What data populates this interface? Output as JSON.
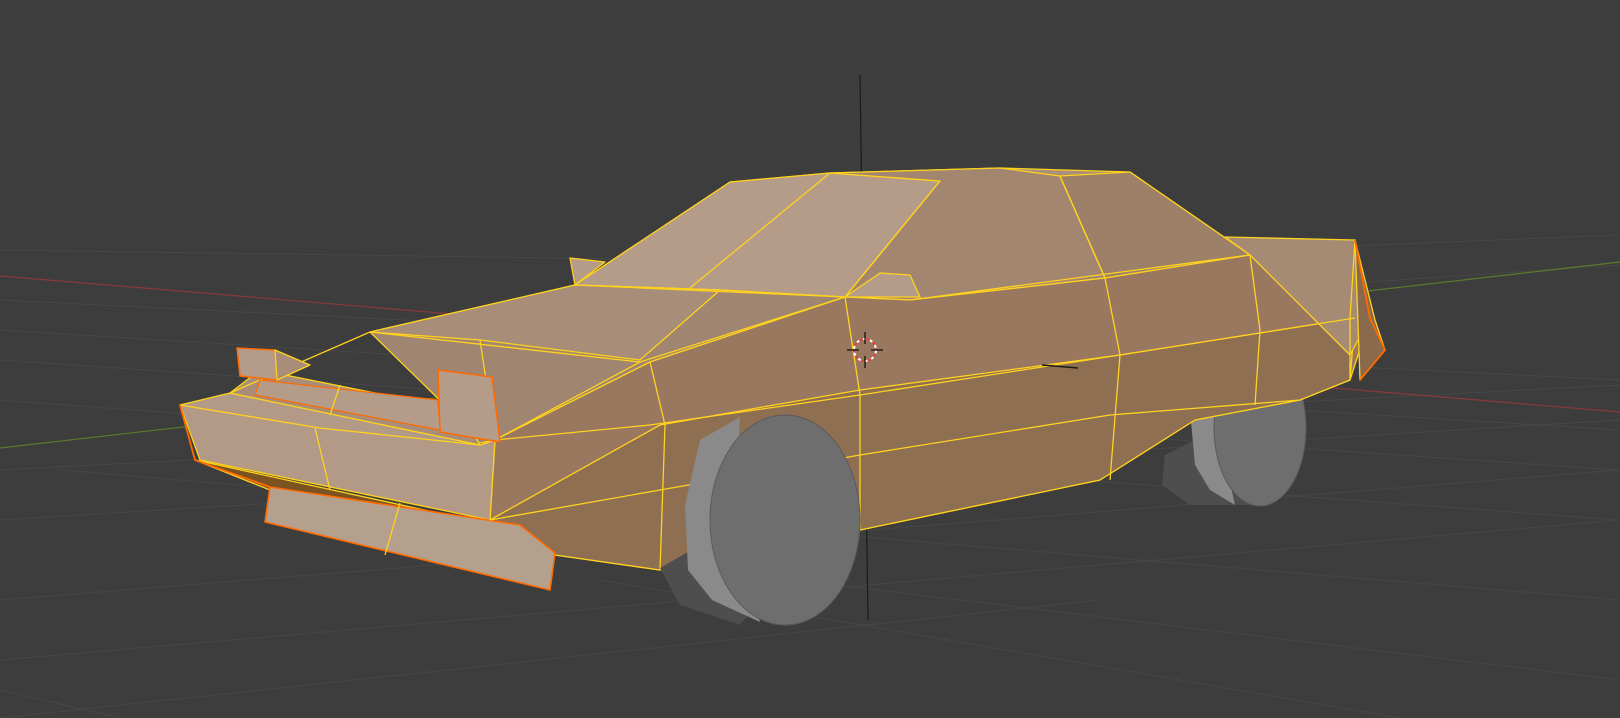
{
  "viewport": {
    "background": "#3d3d3d",
    "grid_color": "#474747",
    "x_axis_color": "#8a3a3a",
    "y_axis_color": "#5b7a2c"
  },
  "selection": {
    "wire_color": "#ffd21e",
    "outline_color": "#ff6a00",
    "body_color": "#a88a70",
    "body_light": "#b59c88",
    "body_dark": "#8a6a4c",
    "underside_color": "#7a5320"
  },
  "wheels": {
    "tire_face": "#6e6e6e",
    "tire_side": "#8a8a8a",
    "tire_shadow": "#4e4e4e"
  },
  "cursor_icon": "3d-cursor-icon",
  "object_origin_icon": "origin-dot-icon"
}
